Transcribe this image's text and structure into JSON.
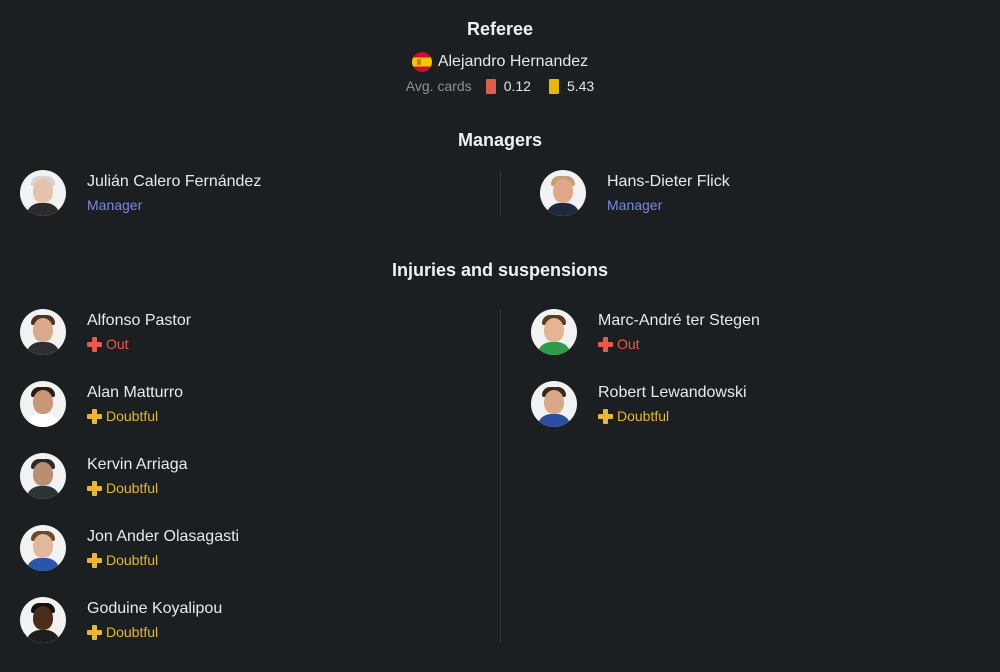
{
  "referee": {
    "heading": "Referee",
    "name": "Alejandro Hernandez",
    "flag_icon": "spain-flag-icon",
    "avg_label": "Avg. cards",
    "red_cards": "0.12",
    "yellow_cards": "5.43",
    "red_color": "#e25b4f",
    "yellow_color": "#e8b50a"
  },
  "managers": {
    "heading": "Managers",
    "home": {
      "name": "Julián Calero Fernández",
      "role": "Manager"
    },
    "away": {
      "name": "Hans-Dieter Flick",
      "role": "Manager"
    }
  },
  "injuries": {
    "heading": "Injuries and suspensions",
    "home": [
      {
        "name": "Alfonso Pastor",
        "status": "Out"
      },
      {
        "name": "Alan Matturro",
        "status": "Doubtful"
      },
      {
        "name": "Kervin Arriaga",
        "status": "Doubtful"
      },
      {
        "name": "Jon Ander Olasagasti",
        "status": "Doubtful"
      },
      {
        "name": "Goduine Koyalipou",
        "status": "Doubtful"
      }
    ],
    "away": [
      {
        "name": "Marc-André ter Stegen",
        "status": "Out"
      },
      {
        "name": "Robert Lewandowski",
        "status": "Doubtful"
      }
    ]
  },
  "colors": {
    "background": "#1b1f22",
    "manager_role": "#7b86e8",
    "status_out": "#e7594a",
    "status_doubtful": "#e6b53c"
  }
}
